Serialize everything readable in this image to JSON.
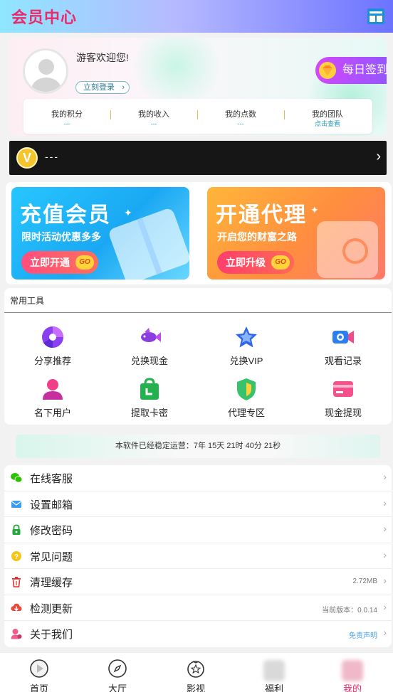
{
  "header": {
    "title": "会员中心"
  },
  "profile": {
    "welcome": "游客欢迎您!",
    "login_label": "立刻登录",
    "checkin_label": "每日签到",
    "stats": [
      {
        "label": "我的积分",
        "value": "---"
      },
      {
        "label": "我的收入",
        "value": "---"
      },
      {
        "label": "我的点数",
        "value": "---"
      },
      {
        "label": "我的团队",
        "value": "点击查看"
      }
    ]
  },
  "vip": {
    "badge": "V",
    "text": "---"
  },
  "promos": [
    {
      "title": "充值会员",
      "subtitle": "限时活动优惠多多",
      "button": "立即开通",
      "go": "GO"
    },
    {
      "title": "开通代理",
      "subtitle": "开启您的财富之路",
      "button": "立即升级",
      "go": "GO"
    }
  ],
  "tools": {
    "title": "常用工具",
    "items": [
      {
        "label": "分享推荐",
        "icon": "share-icon"
      },
      {
        "label": "兑换现金",
        "icon": "fish-icon"
      },
      {
        "label": "兑换VIP",
        "icon": "star-icon"
      },
      {
        "label": "观看记录",
        "icon": "camera-icon"
      },
      {
        "label": "名下用户",
        "icon": "user-icon"
      },
      {
        "label": "提取卡密",
        "icon": "bag-icon"
      },
      {
        "label": "代理专区",
        "icon": "shield-icon"
      },
      {
        "label": "现金提现",
        "icon": "card-icon"
      }
    ]
  },
  "runtime": {
    "text": "本软件已经稳定运营：7年 15天 21时 40分 21秒"
  },
  "menu": [
    {
      "label": "在线客服",
      "value": "",
      "icon": "wechat-icon"
    },
    {
      "label": "设置邮箱",
      "value": "",
      "icon": "mail-icon"
    },
    {
      "label": "修改密码",
      "value": "",
      "icon": "lock-icon"
    },
    {
      "label": "常见问题",
      "value": "",
      "icon": "question-icon"
    },
    {
      "label": "清理缓存",
      "value": "2.72MB",
      "icon": "trash-icon"
    },
    {
      "label": "检测更新",
      "value": "当前版本：0.0.14",
      "icon": "cloud-download-icon"
    },
    {
      "label": "关于我们",
      "value": "免责声明",
      "icon": "about-icon"
    }
  ],
  "nav": [
    {
      "label": "首页",
      "icon": "play-icon"
    },
    {
      "label": "大厅",
      "icon": "compass-icon"
    },
    {
      "label": "影视",
      "icon": "film-icon"
    },
    {
      "label": "福利",
      "icon": "gift-icon"
    },
    {
      "label": "我的",
      "icon": "mine-icon"
    }
  ],
  "colors": {
    "brand": "#ea2b6b",
    "accent": "#8f58ff"
  }
}
